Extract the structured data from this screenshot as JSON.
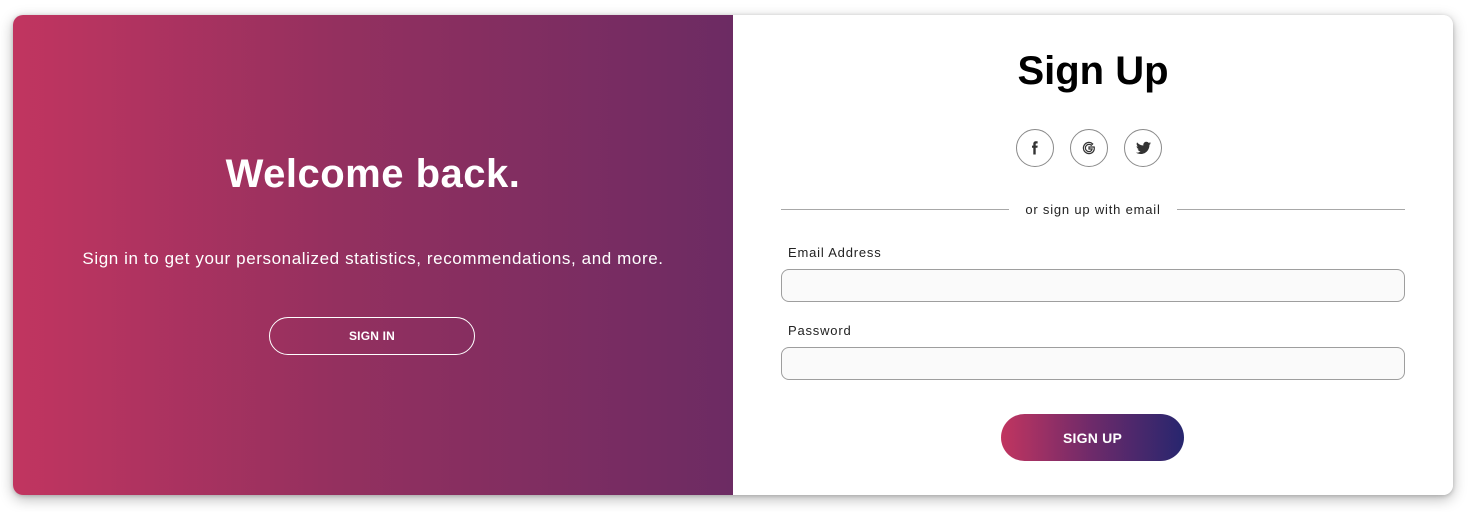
{
  "welcome": {
    "title": "Welcome back.",
    "text": "Sign in to get your personalized statistics, recommendations, and more.",
    "signin_label": "SIGN IN"
  },
  "signup": {
    "title": "Sign Up",
    "social": {
      "facebook_icon": "facebook-icon",
      "google_icon": "google-icon",
      "twitter_icon": "twitter-icon"
    },
    "divider_text": "or sign up with email",
    "email_label": "Email Address",
    "email_value": "",
    "password_label": "Password",
    "password_value": "",
    "submit_label": "SIGN UP"
  },
  "colors": {
    "gradient_start": "#c13560",
    "gradient_end": "#6c2b63",
    "button_gradient_end": "#27266e"
  }
}
